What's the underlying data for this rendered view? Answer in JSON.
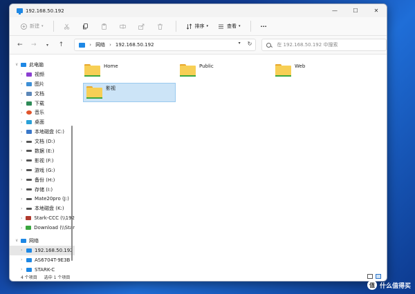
{
  "window": {
    "title": "192.168.50.192",
    "controls": {
      "minimize": "—",
      "maximize": "☐",
      "close": "✕"
    }
  },
  "toolbar": {
    "new_label": "新建",
    "sort_label": "排序",
    "view_label": "查看",
    "more_label": "···"
  },
  "address": {
    "crumbs": [
      "网络",
      "192.168.50.192"
    ],
    "search_placeholder": "在 192.168.50.192 中搜索"
  },
  "sidebar": {
    "items": [
      {
        "label": "此电脑",
        "icon": "computer-icon",
        "color": "#1e88e5"
      },
      {
        "label": "视频",
        "icon": "video-icon",
        "color": "#8b3fd1"
      },
      {
        "label": "图片",
        "icon": "pictures-icon",
        "color": "#3d8fd6"
      },
      {
        "label": "文档",
        "icon": "documents-icon",
        "color": "#5c87b8"
      },
      {
        "label": "下载",
        "icon": "download-icon",
        "color": "#2e8b57"
      },
      {
        "label": "音乐",
        "icon": "music-icon",
        "color": "#e0542b"
      },
      {
        "label": "桌面",
        "icon": "desktop-icon",
        "color": "#2aa0d8"
      },
      {
        "label": "本地磁盘 (C:)",
        "icon": "disk-c-icon",
        "color": "#3a78c9"
      },
      {
        "label": "文档 (D:)",
        "icon": "drive-icon",
        "color": "#555555"
      },
      {
        "label": "数据 (E:)",
        "icon": "drive-icon",
        "color": "#555555"
      },
      {
        "label": "影视 (F:)",
        "icon": "drive-icon",
        "color": "#555555"
      },
      {
        "label": "游戏 (G:)",
        "icon": "drive-icon",
        "color": "#555555"
      },
      {
        "label": "备份 (H:)",
        "icon": "drive-icon",
        "color": "#555555"
      },
      {
        "label": "存储 (I:)",
        "icon": "drive-icon",
        "color": "#555555"
      },
      {
        "label": "Mate20pro (J:)",
        "icon": "drive-icon",
        "color": "#555555"
      },
      {
        "label": "本地磁盘 (K:)",
        "icon": "drive-icon",
        "color": "#555555"
      },
      {
        "label": "Stark-CCC (\\\\192",
        "icon": "network-drive-icon",
        "color": "#b03a2e"
      },
      {
        "label": "Download (\\\\Star",
        "icon": "network-drive-icon",
        "color": "#3aa63f"
      },
      {
        "label": "网络",
        "icon": "network-icon",
        "color": "#1e88e5"
      },
      {
        "label": "192.168.50.192",
        "icon": "server-icon",
        "color": "#1e88e5"
      },
      {
        "label": "AS6704T-9E3B",
        "icon": "server-icon",
        "color": "#1e88e5"
      },
      {
        "label": "STARK-C",
        "icon": "server-icon",
        "color": "#1e88e5"
      }
    ]
  },
  "files": [
    {
      "name": "Home"
    },
    {
      "name": "Public"
    },
    {
      "name": "Web"
    },
    {
      "name": "影视"
    }
  ],
  "status": {
    "count": "4 个项目",
    "selection": "选中 1 个项目"
  },
  "watermark": {
    "logo": "值",
    "text": "什么值得买"
  }
}
